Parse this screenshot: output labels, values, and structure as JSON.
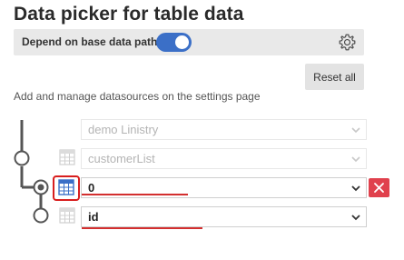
{
  "header": {
    "title": "Data picker for table data"
  },
  "toggle": {
    "label": "Depend on base data path",
    "on": true
  },
  "actions": {
    "reset_label": "Reset all"
  },
  "info": {
    "text": "Add and manage datasources on the settings page"
  },
  "rows": [
    {
      "value": "demo Linistry",
      "disabled": true
    },
    {
      "value": "customerList",
      "disabled": true
    },
    {
      "value": "0",
      "disabled": false
    },
    {
      "value": "id",
      "disabled": false
    }
  ],
  "colors": {
    "accent": "#3b6fc7",
    "toolbar_bg": "#e9e9e9",
    "highlight": "#d81e1e",
    "delete": "#e0414d"
  }
}
